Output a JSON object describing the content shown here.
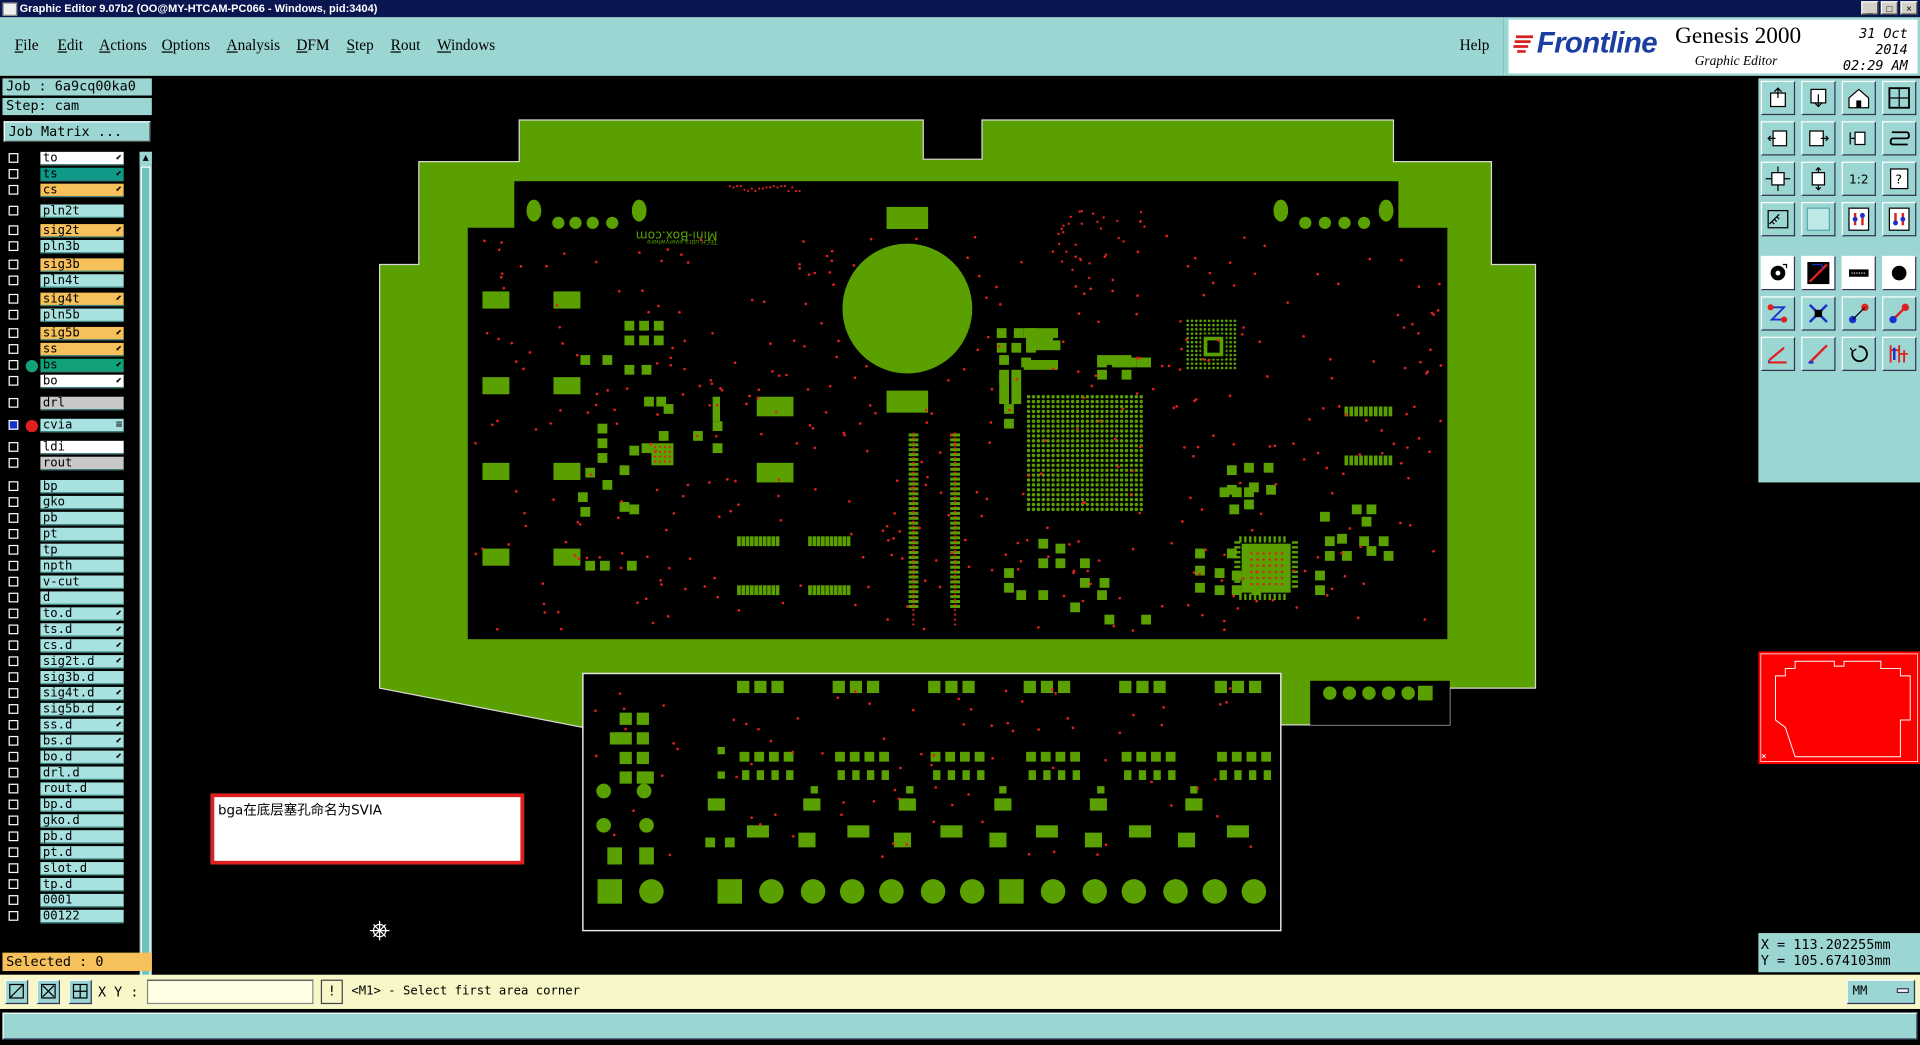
{
  "window": {
    "title": "Graphic Editor 9.07b2 (OO@MY-HTCAM-PC066 - Windows, pid:3404)",
    "controls": [
      "_",
      "□",
      "×"
    ]
  },
  "menu": {
    "items": [
      {
        "label": "File",
        "key": "F"
      },
      {
        "label": "Edit",
        "key": "E"
      },
      {
        "label": "Actions",
        "key": "A"
      },
      {
        "label": "Options",
        "key": "O"
      },
      {
        "label": "Analysis",
        "key": "A"
      },
      {
        "label": "DFM",
        "key": "D"
      },
      {
        "label": "Step",
        "key": "S"
      },
      {
        "label": "Rout",
        "key": "R"
      },
      {
        "label": "Windows",
        "key": "W"
      }
    ],
    "help": "Help"
  },
  "brand": {
    "logo": "Frontline",
    "product": "Genesis 2000",
    "subtitle": "Graphic Editor",
    "date": "31 Oct 2014",
    "time": "02:29 AM"
  },
  "job": {
    "job_label": "Job : 6a9cq00ka0",
    "step_label": "Step: cam",
    "matrix_button": "Job Matrix ..."
  },
  "layers": [
    {
      "name": "to",
      "color": "white",
      "marker": "⬋",
      "on": false,
      "symbol": ""
    },
    {
      "name": "ts",
      "color": "teal",
      "marker": "⬋",
      "on": false,
      "symbol": ""
    },
    {
      "name": "cs",
      "color": "orange",
      "marker": "⬋",
      "on": false,
      "symbol": ""
    },
    {
      "name": "pln2t",
      "color": "pale",
      "marker": "",
      "on": false,
      "symbol": ""
    },
    {
      "name": "sig2t",
      "color": "orange",
      "marker": "⬋",
      "on": false,
      "symbol": ""
    },
    {
      "name": "pln3b",
      "color": "pale",
      "marker": "",
      "on": false,
      "symbol": ""
    },
    {
      "name": "sig3b",
      "color": "orange",
      "marker": "",
      "on": false,
      "symbol": ""
    },
    {
      "name": "pln4t",
      "color": "pale",
      "marker": "",
      "on": false,
      "symbol": ""
    },
    {
      "name": "sig4t",
      "color": "orange",
      "marker": "⬋",
      "on": false,
      "symbol": ""
    },
    {
      "name": "pln5b",
      "color": "pale",
      "marker": "",
      "on": false,
      "symbol": ""
    },
    {
      "name": "sig5b",
      "color": "orange",
      "marker": "⬋",
      "on": false,
      "symbol": ""
    },
    {
      "name": "ss",
      "color": "orange",
      "marker": "⬋",
      "on": false,
      "symbol": ""
    },
    {
      "name": "bs",
      "color": "green",
      "marker": "⬋",
      "on": false,
      "symbol": "#11a27a"
    },
    {
      "name": "bo",
      "color": "white",
      "marker": "⬋",
      "on": false,
      "symbol": ""
    },
    {
      "name": "drl",
      "color": "gray",
      "marker": "",
      "on": false,
      "symbol": ""
    },
    {
      "name": "cvia",
      "color": "pale",
      "marker": "≡",
      "on": true,
      "symbol": "#e02020"
    },
    {
      "name": "ldi",
      "color": "white",
      "marker": "",
      "on": false,
      "symbol": ""
    },
    {
      "name": "rout",
      "color": "gray",
      "marker": "",
      "on": false,
      "symbol": ""
    },
    {
      "name": "bp",
      "color": "pale",
      "marker": "",
      "on": false,
      "symbol": ""
    },
    {
      "name": "gko",
      "color": "pale",
      "marker": "",
      "on": false,
      "symbol": ""
    },
    {
      "name": "pb",
      "color": "pale",
      "marker": "",
      "on": false,
      "symbol": ""
    },
    {
      "name": "pt",
      "color": "pale",
      "marker": "",
      "on": false,
      "symbol": ""
    },
    {
      "name": "tp",
      "color": "pale",
      "marker": "",
      "on": false,
      "symbol": ""
    },
    {
      "name": "npth",
      "color": "pale",
      "marker": "",
      "on": false,
      "symbol": ""
    },
    {
      "name": "v-cut",
      "color": "pale",
      "marker": "",
      "on": false,
      "symbol": ""
    },
    {
      "name": "d",
      "color": "pale",
      "marker": "",
      "on": false,
      "symbol": ""
    },
    {
      "name": "to.d",
      "color": "pale",
      "marker": "⬋",
      "on": false,
      "symbol": ""
    },
    {
      "name": "ts.d",
      "color": "pale",
      "marker": "⬋",
      "on": false,
      "symbol": ""
    },
    {
      "name": "cs.d",
      "color": "pale",
      "marker": "⬋",
      "on": false,
      "symbol": ""
    },
    {
      "name": "sig2t.d",
      "color": "pale",
      "marker": "⬋",
      "on": false,
      "symbol": ""
    },
    {
      "name": "sig3b.d",
      "color": "pale",
      "marker": "",
      "on": false,
      "symbol": ""
    },
    {
      "name": "sig4t.d",
      "color": "pale",
      "marker": "⬋",
      "on": false,
      "symbol": ""
    },
    {
      "name": "sig5b.d",
      "color": "pale",
      "marker": "⬋",
      "on": false,
      "symbol": ""
    },
    {
      "name": "ss.d",
      "color": "pale",
      "marker": "⬋",
      "on": false,
      "symbol": ""
    },
    {
      "name": "bs.d",
      "color": "pale",
      "marker": "⬋",
      "on": false,
      "symbol": ""
    },
    {
      "name": "bo.d",
      "color": "pale",
      "marker": "⬋",
      "on": false,
      "symbol": ""
    },
    {
      "name": "drl.d",
      "color": "pale",
      "marker": "",
      "on": false,
      "symbol": ""
    },
    {
      "name": "rout.d",
      "color": "pale",
      "marker": "",
      "on": false,
      "symbol": ""
    },
    {
      "name": "bp.d",
      "color": "pale",
      "marker": "",
      "on": false,
      "symbol": ""
    },
    {
      "name": "gko.d",
      "color": "pale",
      "marker": "",
      "on": false,
      "symbol": ""
    },
    {
      "name": "pb.d",
      "color": "pale",
      "marker": "",
      "on": false,
      "symbol": ""
    },
    {
      "name": "pt.d",
      "color": "pale",
      "marker": "",
      "on": false,
      "symbol": ""
    },
    {
      "name": "slot.d",
      "color": "pale",
      "marker": "",
      "on": false,
      "symbol": ""
    },
    {
      "name": "tp.d",
      "color": "pale",
      "marker": "",
      "on": false,
      "symbol": ""
    },
    {
      "name": "0001",
      "color": "pale",
      "marker": "",
      "on": false,
      "symbol": ""
    },
    {
      "name": "00122",
      "color": "pale",
      "marker": "",
      "on": false,
      "symbol": ""
    }
  ],
  "selected_label": "Selected : 0",
  "canvas": {
    "note": "bga在底层塞孔命名为SVIA",
    "silk_brand": "Mini-Box.com",
    "silk_sub": "TECH ultra everywhere"
  },
  "tools": [
    {
      "name": "open-icon"
    },
    {
      "name": "save-icon"
    },
    {
      "name": "home-icon"
    },
    {
      "name": "zoom-window-icon"
    },
    {
      "name": "pan-left-icon"
    },
    {
      "name": "pan-right-icon"
    },
    {
      "name": "mirror-icon"
    },
    {
      "name": "scroll-icon"
    },
    {
      "name": "fit-icon"
    },
    {
      "name": "center-icon"
    },
    {
      "name": "scale-1-2-icon"
    },
    {
      "name": "query-icon"
    },
    {
      "name": "measure-icon"
    },
    {
      "name": "grid-icon"
    },
    {
      "name": "layer-up-icon"
    },
    {
      "name": "layer-down-icon"
    },
    {
      "name": "pad-icon"
    },
    {
      "name": "line-draw-icon"
    },
    {
      "name": "slot-icon"
    },
    {
      "name": "circle-icon"
    },
    {
      "name": "net-icon"
    },
    {
      "name": "cross-icon"
    },
    {
      "name": "connect-icon"
    },
    {
      "name": "route-icon"
    },
    {
      "name": "trace-icon"
    },
    {
      "name": "diagonal-icon"
    },
    {
      "name": "rotate-icon"
    },
    {
      "name": "split-icon"
    }
  ],
  "coords": {
    "x_label": "X = 113.202255mm",
    "y_label": "Y = 105.674103mm"
  },
  "status": {
    "xy_label": "X Y :",
    "xy_value": "",
    "prompt": "<M1> - Select first area corner",
    "unit": "MM"
  },
  "colors": {
    "board": "#5aa000",
    "via": "#e02020",
    "ui_panel": "#9cd6d2",
    "selected_bg": "#f6c15b"
  }
}
